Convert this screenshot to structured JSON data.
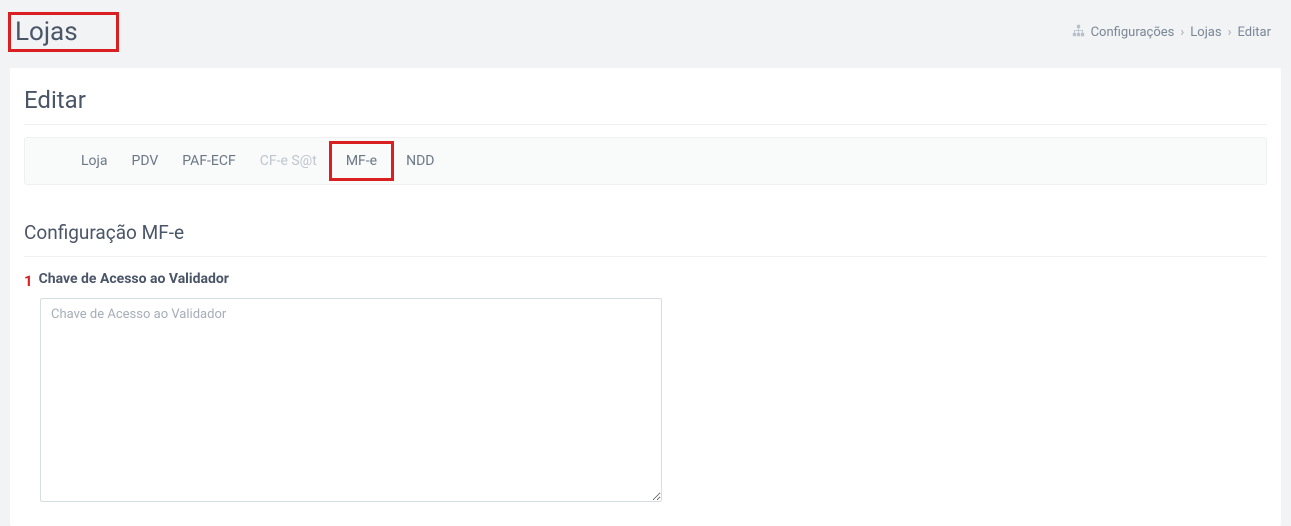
{
  "header": {
    "title": "Lojas",
    "breadcrumb": {
      "item1": "Configurações",
      "item2": "Lojas",
      "item3": "Editar"
    }
  },
  "panel": {
    "title": "Editar",
    "tabs": {
      "loja": "Loja",
      "pdv": "PDV",
      "pafecf": "PAF-ECF",
      "cfesat": "CF-e S@t",
      "mfe": "MF-e",
      "ndd": "NDD"
    },
    "section": {
      "title": "Configuração MF-e",
      "field": {
        "marker": "1",
        "label": "Chave de Acesso ao Validador",
        "placeholder": "Chave de Acesso ao Validador",
        "value": ""
      }
    }
  }
}
